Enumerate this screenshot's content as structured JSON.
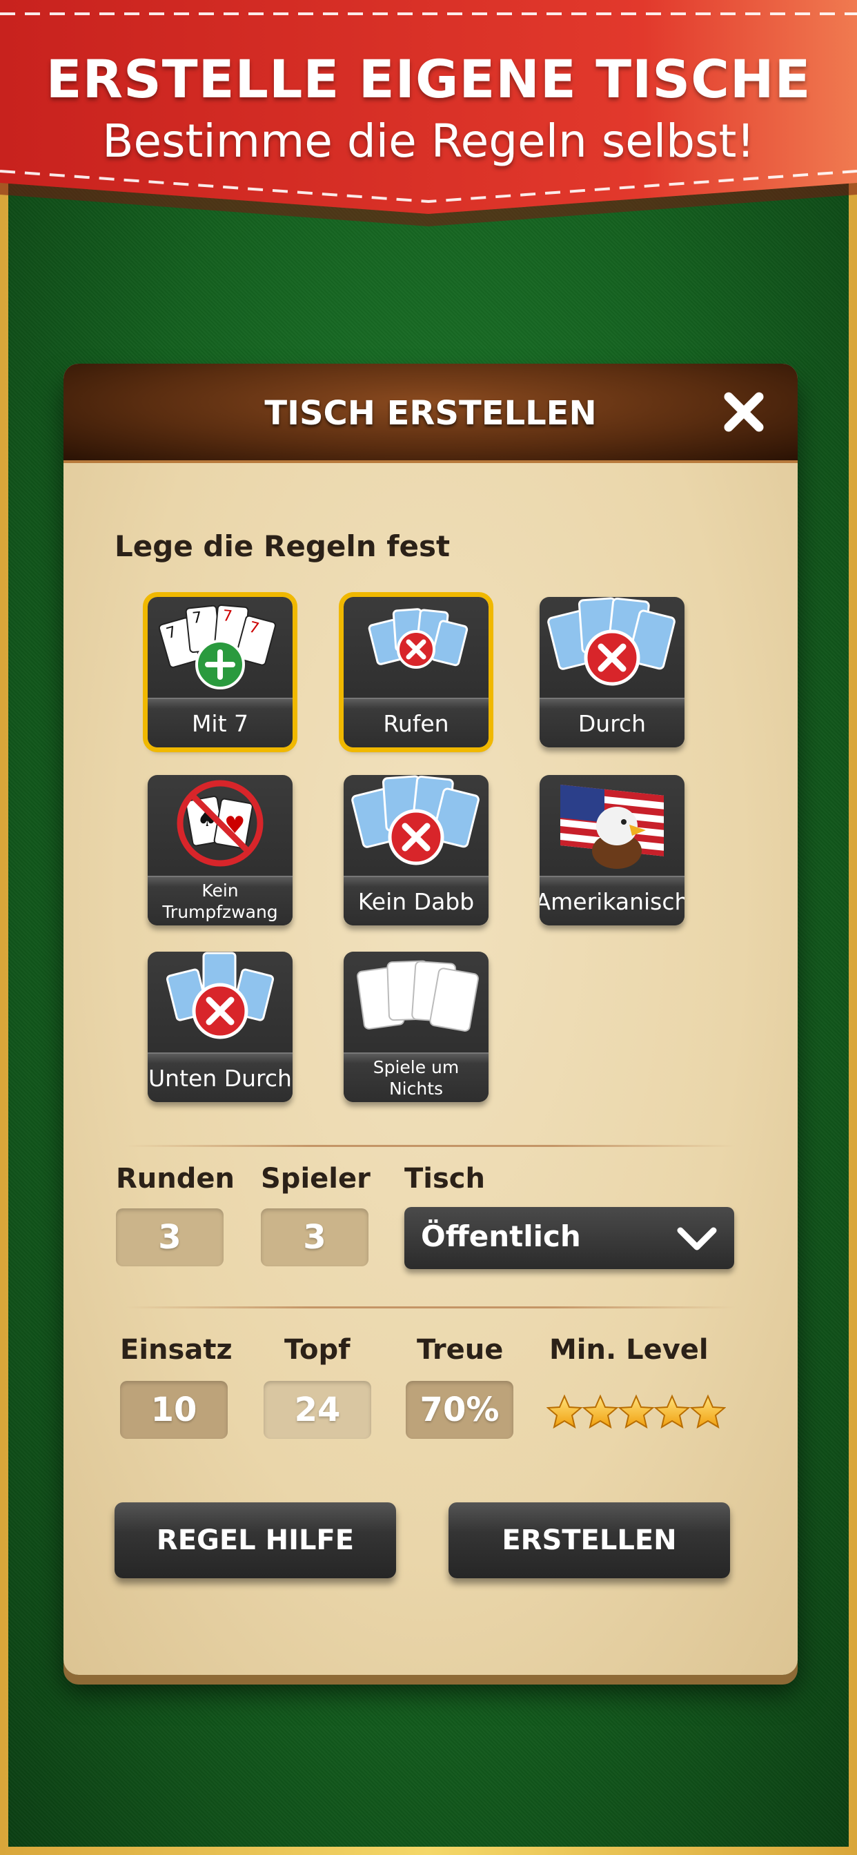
{
  "banner": {
    "title": "ERSTELLE EIGENE TISCHE",
    "subtitle": "Bestimme die Regeln selbst!"
  },
  "dialog": {
    "title": "TISCH ERSTELLEN",
    "close_icon": "close-icon",
    "rules_heading": "Lege die Regeln fest",
    "rules": [
      {
        "label": "Mit 7",
        "selected": true,
        "icon": "cards-plus-icon"
      },
      {
        "label": "Rufen",
        "selected": true,
        "icon": "cards-x-icon"
      },
      {
        "label": "Durch",
        "selected": false,
        "icon": "cards-x-icon"
      },
      {
        "label": "Kein Trumpfzwang",
        "selected": false,
        "icon": "no-trump-icon"
      },
      {
        "label": "Kein Dabb",
        "selected": false,
        "icon": "cards-x-icon"
      },
      {
        "label": "Amerikanisch",
        "selected": false,
        "icon": "eagle-flag-icon"
      },
      {
        "label": "Unten Durch",
        "selected": false,
        "icon": "cards-x-icon"
      },
      {
        "label": "Spiele um Nichts",
        "selected": false,
        "icon": "blank-cards-icon"
      }
    ],
    "fields": {
      "runden_label": "Runden",
      "runden_value": "3",
      "spieler_label": "Spieler",
      "spieler_value": "3",
      "tisch_label": "Tisch",
      "tisch_value": "Öffentlich",
      "einsatz_label": "Einsatz",
      "einsatz_value": "10",
      "topf_label": "Topf",
      "topf_value": "24",
      "treue_label": "Treue",
      "treue_value": "70%",
      "minlevel_label": "Min. Level",
      "minlevel_stars": 5
    },
    "buttons": {
      "help": "REGEL HILFE",
      "create": "ERSTELLEN"
    }
  },
  "colors": {
    "banner_red": "#d8322b",
    "felt_green": "#1a6e26",
    "gold_selected": "#f0b800",
    "paper": "#ead6aa",
    "header_wood": "#5a2d10"
  }
}
